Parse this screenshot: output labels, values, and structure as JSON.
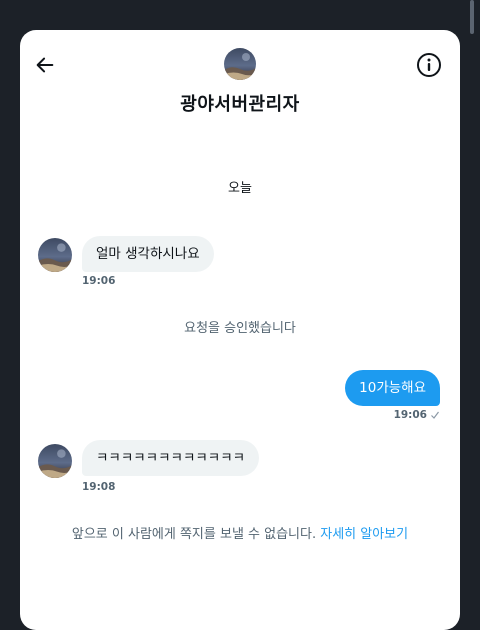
{
  "header": {
    "title": "광야서버관리자"
  },
  "conversation": {
    "date_divider": "오늘",
    "messages": [
      {
        "direction": "incoming",
        "text": "얼마 생각하시나요",
        "time": "19:06"
      },
      {
        "type": "system",
        "text": "요청을 승인했습니다"
      },
      {
        "direction": "outgoing",
        "text": "10가능해요",
        "time": "19:06"
      },
      {
        "direction": "incoming",
        "text": "ㅋㅋㅋㅋㅋㅋㅋㅋㅋㅋㅋㅋ",
        "time": "19:08"
      }
    ]
  },
  "footer": {
    "notice": "앞으로 이 사람에게 쪽지를 보낼 수 없습니다.",
    "link": "자세히 알아보기"
  },
  "colors": {
    "accent": "#1d9bf0",
    "bubble_incoming": "#eff3f4",
    "muted_text": "#536471",
    "background": "#1c2128"
  },
  "icons": {
    "back": "arrow-left-icon",
    "info": "info-circle-icon",
    "read": "check-icon"
  }
}
